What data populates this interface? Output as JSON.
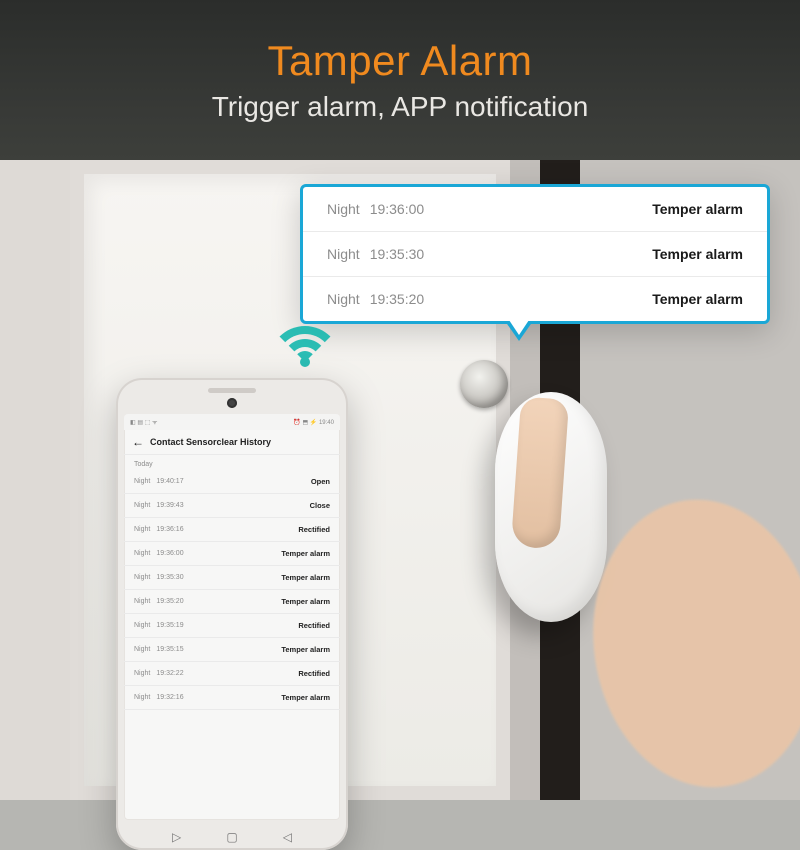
{
  "header": {
    "title": "Tamper Alarm",
    "subtitle": "Trigger alarm, APP notification"
  },
  "callout": {
    "rows": [
      {
        "period": "Night",
        "time": "19:36:00",
        "status": "Temper alarm"
      },
      {
        "period": "Night",
        "time": "19:35:30",
        "status": "Temper alarm"
      },
      {
        "period": "Night",
        "time": "19:35:20",
        "status": "Temper alarm"
      }
    ]
  },
  "phone": {
    "statusbar_left": "◧ ▤ ⬚ ᯤ",
    "statusbar_right": "⏰ ⬒ ⚡ 19:40",
    "topbar_title": "Contact Sensorclear History",
    "section_label": "Today",
    "history": [
      {
        "period": "Night",
        "time": "19:40:17",
        "status": "Open"
      },
      {
        "period": "Night",
        "time": "19:39:43",
        "status": "Close"
      },
      {
        "period": "Night",
        "time": "19:36:16",
        "status": "Rectified"
      },
      {
        "period": "Night",
        "time": "19:36:00",
        "status": "Temper alarm"
      },
      {
        "period": "Night",
        "time": "19:35:30",
        "status": "Temper alarm"
      },
      {
        "period": "Night",
        "time": "19:35:20",
        "status": "Temper alarm"
      },
      {
        "period": "Night",
        "time": "19:35:19",
        "status": "Rectified"
      },
      {
        "period": "Night",
        "time": "19:35:15",
        "status": "Temper alarm"
      },
      {
        "period": "Night",
        "time": "19:32:22",
        "status": "Rectified"
      },
      {
        "period": "Night",
        "time": "19:32:16",
        "status": "Temper alarm"
      }
    ]
  },
  "icons": {
    "wifi": "wifi-icon",
    "back": "←",
    "nav_back": "◁",
    "nav_home": "▢",
    "nav_recent": "◁"
  }
}
